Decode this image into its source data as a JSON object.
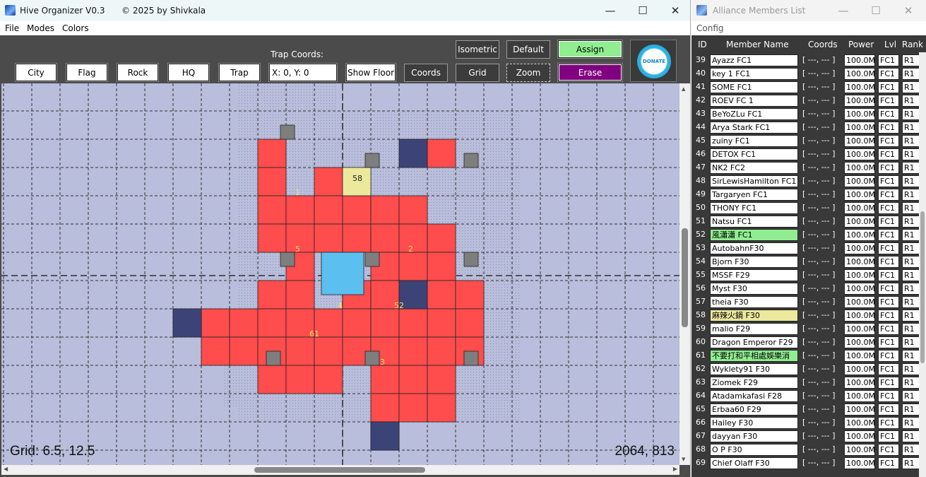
{
  "main_window": {
    "title": "Hive Organizer V0.3",
    "copyright": "© 2025 by Shivkala",
    "controls": {
      "minimize": "—",
      "maximize": "☐",
      "close": "✕"
    }
  },
  "menu": {
    "file": "File",
    "modes": "Modes",
    "colors": "Colors"
  },
  "toolbar": {
    "city": "City",
    "flag": "Flag",
    "rock": "Rock",
    "hq": "HQ",
    "trap": "Trap",
    "trap_coords_label": "Trap Coords:",
    "trap_coords_value": "X: 0, Y: 0",
    "show_floor": "Show Floor",
    "coords": "Coords",
    "grid": "Grid",
    "zoom": "Zoom",
    "isometric": "Isometric",
    "default": "Default",
    "assign": "Assign",
    "erase": "Erase",
    "donate": "DONATE"
  },
  "map": {
    "status_grid": "Grid: 6.5, 12.5",
    "status_pos": "2064, 813",
    "labels": [
      "1",
      "58",
      "5",
      "2",
      "4",
      "52",
      "61",
      "3"
    ],
    "colors": {
      "city": "#ff4c4c",
      "hq": "#5bbff0",
      "rock": "#3c4477",
      "flag": "#7e7e7e",
      "assigned": "#ece89c",
      "floor": "#b8bedb"
    }
  },
  "side_window": {
    "title": "Alliance Members List",
    "controls": {
      "minimize": "—",
      "maximize": "☐",
      "close": "✕"
    },
    "menu": {
      "config": "Config"
    },
    "headers": {
      "id": "ID",
      "name": "Member Name",
      "coords": "Coords",
      "power": "Power",
      "lvl": "Lvl",
      "rank": "Rank"
    },
    "members": [
      {
        "id": "39",
        "name": "Ayazz FC1",
        "coords": "[ ---, --- ]",
        "power": "100.0M",
        "lvl": "FC1",
        "rank": "R1"
      },
      {
        "id": "40",
        "name": "key 1 FC1",
        "coords": "[ ---, --- ]",
        "power": "100.0M",
        "lvl": "FC1",
        "rank": "R1"
      },
      {
        "id": "41",
        "name": "SOME FC1",
        "coords": "[ ---, --- ]",
        "power": "100.0M",
        "lvl": "FC1",
        "rank": "R1"
      },
      {
        "id": "42",
        "name": "ROEV FC 1",
        "coords": "[ ---, --- ]",
        "power": "100.0M",
        "lvl": "FC1",
        "rank": "R1"
      },
      {
        "id": "43",
        "name": "BeYoZLu FC1",
        "coords": "[ ---, --- ]",
        "power": "100.0M",
        "lvl": "FC1",
        "rank": "R1"
      },
      {
        "id": "44",
        "name": "Arya Stark FC1",
        "coords": "[ ---, --- ]",
        "power": "100.0M",
        "lvl": "FC1",
        "rank": "R1"
      },
      {
        "id": "45",
        "name": "zuiny FC1",
        "coords": "[ ---, --- ]",
        "power": "100.0M",
        "lvl": "FC1",
        "rank": "R1"
      },
      {
        "id": "46",
        "name": "DETOX FC1",
        "coords": "[ ---, --- ]",
        "power": "100.0M",
        "lvl": "FC1",
        "rank": "R1"
      },
      {
        "id": "47",
        "name": "NK2 FC2",
        "coords": "[ ---, --- ]",
        "power": "100.0M",
        "lvl": "FC1",
        "rank": "R1"
      },
      {
        "id": "48",
        "name": "SirLewisHamilton FC1",
        "coords": "[ ---, --- ]",
        "power": "100.0M",
        "lvl": "FC1",
        "rank": "R1"
      },
      {
        "id": "49",
        "name": "Targaryen FC1",
        "coords": "[ ---, --- ]",
        "power": "100.0M",
        "lvl": "FC1",
        "rank": "R1"
      },
      {
        "id": "50",
        "name": "THONY FC1",
        "coords": "[ ---, --- ]",
        "power": "100.0M",
        "lvl": "FC1",
        "rank": "R1"
      },
      {
        "id": "51",
        "name": "Natsu FC1",
        "coords": "[ ---, --- ]",
        "power": "100.0M",
        "lvl": "FC1",
        "rank": "R1"
      },
      {
        "id": "52",
        "name": "風瀟瀟 FC1",
        "coords": "[ ---, --- ]",
        "power": "100.0M",
        "lvl": "FC1",
        "rank": "R1",
        "highlight": "#90ee90"
      },
      {
        "id": "53",
        "name": "AutobahnF30",
        "coords": "[ ---, --- ]",
        "power": "100.0M",
        "lvl": "FC1",
        "rank": "R1"
      },
      {
        "id": "54",
        "name": "Bjorn F30",
        "coords": "[ ---, --- ]",
        "power": "100.0M",
        "lvl": "FC1",
        "rank": "R1"
      },
      {
        "id": "55",
        "name": "MSSF F29",
        "coords": "[ ---, --- ]",
        "power": "100.0M",
        "lvl": "FC1",
        "rank": "R1"
      },
      {
        "id": "56",
        "name": "Myst F30",
        "coords": "[ ---, --- ]",
        "power": "100.0M",
        "lvl": "FC1",
        "rank": "R1"
      },
      {
        "id": "57",
        "name": "theia F30",
        "coords": "[ ---, --- ]",
        "power": "100.0M",
        "lvl": "FC1",
        "rank": "R1"
      },
      {
        "id": "58",
        "name": "麻辣火鍋 F30",
        "coords": "[ ---, --- ]",
        "power": "100.0M",
        "lvl": "FC1",
        "rank": "R1",
        "highlight": "#ece89c"
      },
      {
        "id": "59",
        "name": "malio F29",
        "coords": "[ ---, --- ]",
        "power": "100.0M",
        "lvl": "FC1",
        "rank": "R1"
      },
      {
        "id": "60",
        "name": "Dragon Emperor F29",
        "coords": "[ ---, --- ]",
        "power": "100.0M",
        "lvl": "FC1",
        "rank": "R1"
      },
      {
        "id": "61",
        "name": "不要打和平相處娛樂消",
        "coords": "[ ---, --- ]",
        "power": "100.0M",
        "lvl": "FC1",
        "rank": "R1",
        "highlight": "#90ee90"
      },
      {
        "id": "62",
        "name": "Wyklety91 F30",
        "coords": "[ ---, --- ]",
        "power": "100.0M",
        "lvl": "FC1",
        "rank": "R1"
      },
      {
        "id": "63",
        "name": "Ziomek F29",
        "coords": "[ ---, --- ]",
        "power": "100.0M",
        "lvl": "FC1",
        "rank": "R1"
      },
      {
        "id": "64",
        "name": "Atadamkafasi F28",
        "coords": "[ ---, --- ]",
        "power": "100.0M",
        "lvl": "FC1",
        "rank": "R1"
      },
      {
        "id": "65",
        "name": "Erbaa60 F29",
        "coords": "[ ---, --- ]",
        "power": "100.0M",
        "lvl": "FC1",
        "rank": "R1"
      },
      {
        "id": "66",
        "name": "Hailey F30",
        "coords": "[ ---, --- ]",
        "power": "100.0M",
        "lvl": "FC1",
        "rank": "R1"
      },
      {
        "id": "67",
        "name": "dayyan F30",
        "coords": "[ ---, --- ]",
        "power": "100.0M",
        "lvl": "FC1",
        "rank": "R1"
      },
      {
        "id": "68",
        "name": "O P F30",
        "coords": "[ ---, --- ]",
        "power": "100.0M",
        "lvl": "FC1",
        "rank": "R1"
      },
      {
        "id": "69",
        "name": "Chief Olaff F30",
        "coords": "[ ---, --- ]",
        "power": "100.0M",
        "lvl": "FC1",
        "rank": "R1"
      }
    ]
  }
}
